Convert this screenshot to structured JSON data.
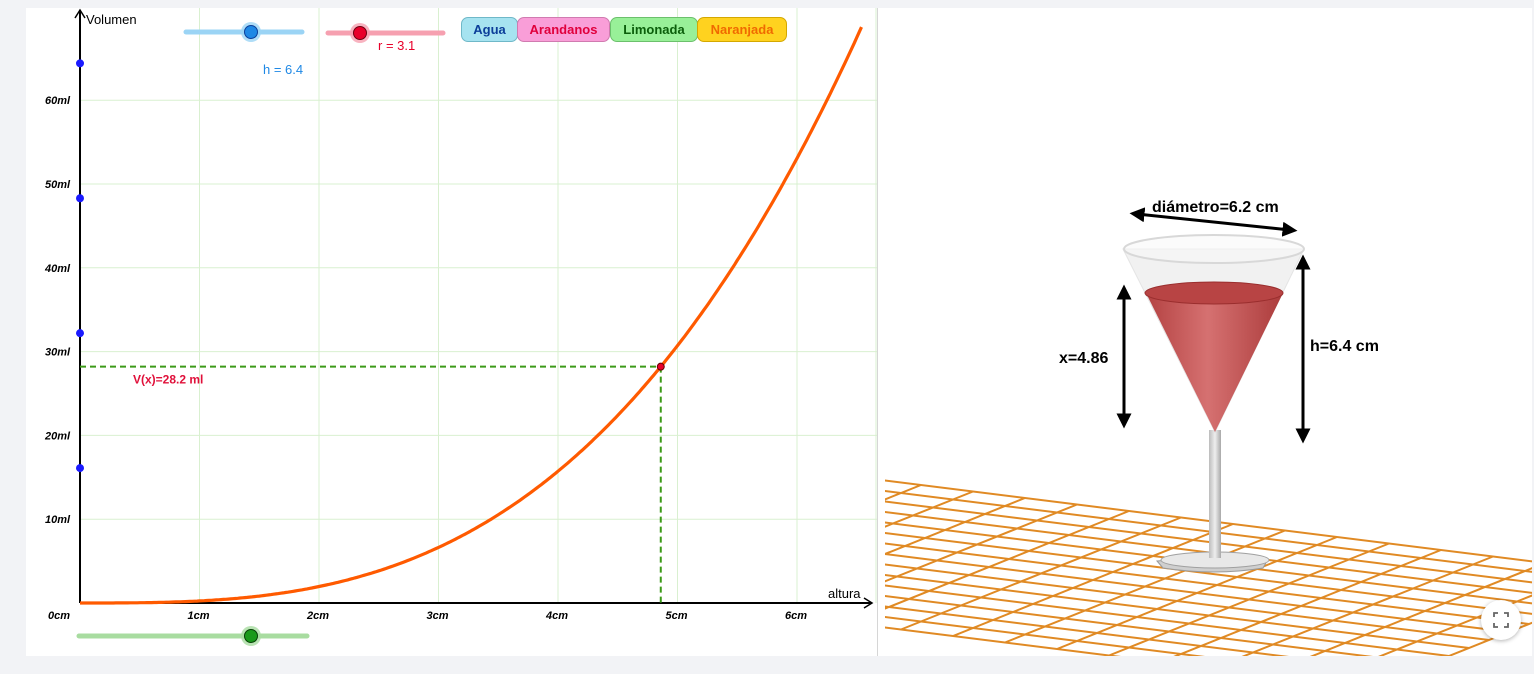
{
  "graph": {
    "y_axis_label": "Volumen",
    "x_axis_label": "altura",
    "origin_label": "0cm",
    "x_ticks": [
      "1cm",
      "2cm",
      "3cm",
      "4cm",
      "5cm",
      "6cm"
    ],
    "y_ticks": [
      "10ml",
      "20ml",
      "30ml",
      "40ml",
      "50ml",
      "60ml"
    ],
    "curve_color": "#ff5a00",
    "grid_color": "#d9f0d0",
    "guide_color": "#3c9a18",
    "volume_label": "V(x)=28.2 ml"
  },
  "sliders": {
    "h": {
      "label": "h = 6.4",
      "value": 6.4,
      "color": "#1e88e5",
      "track_color": "#9bd4f5"
    },
    "r": {
      "label": "r = 3.1",
      "value": 3.1,
      "color": "#e8002a",
      "track_color": "#f6a0b0"
    },
    "x": {
      "value": 4.86,
      "color": "#1a9a1a",
      "track_color": "#a8dca0"
    }
  },
  "buttons": [
    {
      "label": "Agua",
      "bg": "#a6e3f0",
      "fg": "#0b3e99"
    },
    {
      "label": "Arandanos",
      "bg": "#f99ed8",
      "fg": "#e0003c"
    },
    {
      "label": "Limonada",
      "bg": "#98f098",
      "fg": "#0b5e0b"
    },
    {
      "label": "Naranjada",
      "bg": "#ffd21f",
      "fg": "#f06a00"
    }
  ],
  "view3d": {
    "diameter_label": "diámetro=6.2 cm",
    "height_label": "h=6.4 cm",
    "x_label": "x=4.86",
    "liquid_color": "#c84a4a",
    "floor_grid_color": "#e08a24"
  },
  "chart_data": {
    "type": "line",
    "xlabel": "altura",
    "ylabel": "Volumen",
    "xlim": [
      0,
      6.55
    ],
    "ylim": [
      0,
      70
    ],
    "series": [
      {
        "function": "V(x)=π·r²·x³/(3·h²)",
        "r": 3.1,
        "h": 6.4
      }
    ],
    "point": {
      "x": 4.86,
      "y": 28.2
    },
    "axis_markers_y": [
      16.1,
      32.2,
      48.3,
      64.4
    ]
  }
}
